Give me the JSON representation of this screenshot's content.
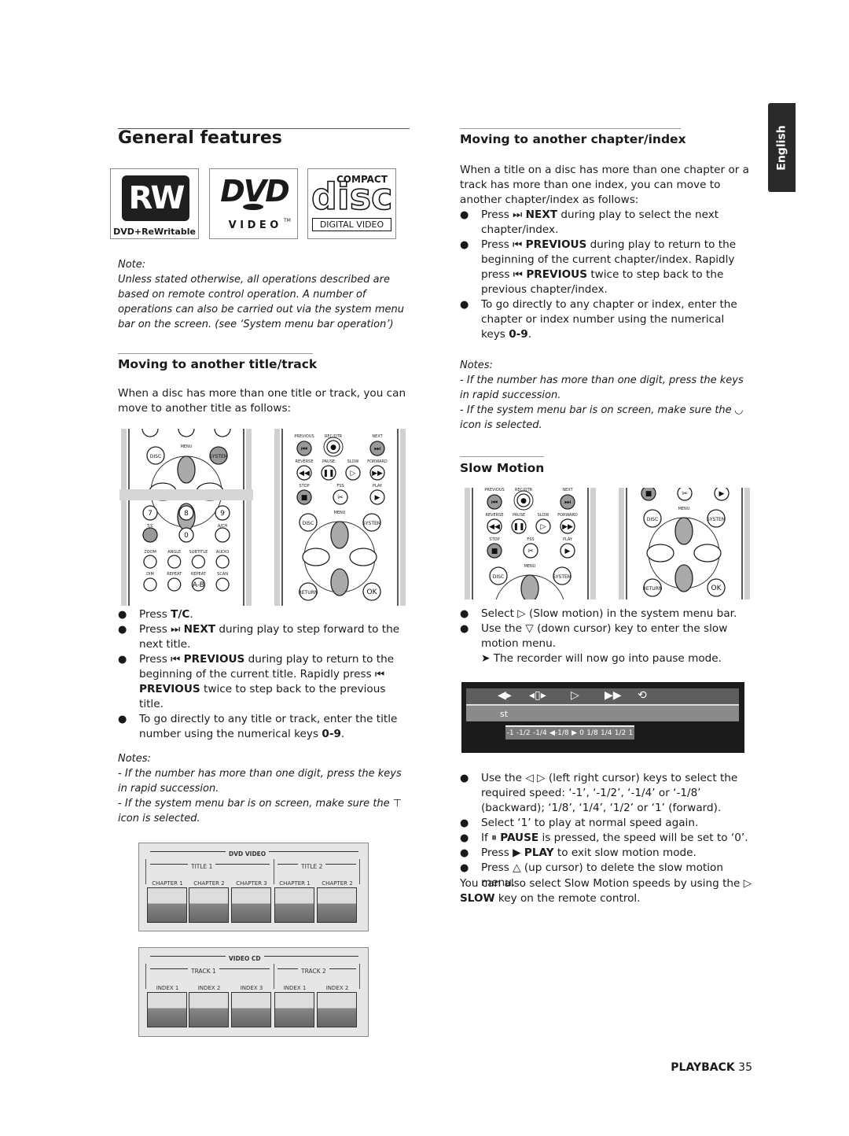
{
  "side_tab": "English",
  "left": {
    "title": "General features",
    "logos": {
      "rw": "RW",
      "rw_caption": "DVD+ReWritable",
      "dvd": "DVD",
      "dvd_sub": "V I D E O",
      "dvd_tm": "TM",
      "cd_top": "COMPACT",
      "cd_main": "disc",
      "cd_caption": "DIGITAL VIDEO"
    },
    "note_label": "Note:",
    "note_text": "Unless stated otherwise, all operations described are based on remote control operation. A number of operations can also be carried out via the system menu bar on the screen. (see ‘System menu bar operation’)",
    "section_title": "Moving to another title/track",
    "intro": "When a disc has more than one title or track, you can move to another title as follows:",
    "bullets": [
      {
        "pre": "Press ",
        "key": "T/C",
        "post": "."
      },
      {
        "pre": "Press ⏭ ",
        "key": "NEXT",
        "post": " during play to step forward to the next title."
      },
      {
        "pre": "Press ⏮ ",
        "key": "PREVIOUS",
        "post": " during play to return to the beginning of the current title. Rapidly press ⏮ ",
        "key2": "PREVIOUS",
        "post2": " twice to step back to the previous title."
      },
      {
        "pre": "To go directly to any title or track, enter the title number using the numerical keys ",
        "key": "0-9",
        "post": "."
      }
    ],
    "notes_label": "Notes:",
    "notes": [
      "- If the number has more than one digit, press the keys in rapid succession.",
      "- If the system menu bar is on screen, make sure the ⊤ icon is selected."
    ],
    "dvd_diagram": {
      "title": "DVD VIDEO",
      "groups": [
        "TITLE 1",
        "TITLE 2"
      ],
      "items": [
        "CHAPTER 1",
        "CHAPTER 2",
        "CHAPTER 3",
        "CHAPTER 1",
        "CHAPTER 2"
      ]
    },
    "vcd_diagram": {
      "title": "VIDEO CD",
      "groups": [
        "TRACK 1",
        "TRACK 2"
      ],
      "items": [
        "INDEX 1",
        "INDEX 2",
        "INDEX 3",
        "INDEX 1",
        "INDEX 2"
      ]
    }
  },
  "remote_a": {
    "menu": "MENU",
    "disc": "DISC",
    "system": "SYSTEM",
    "nums": [
      "7",
      "8",
      "9",
      "0"
    ],
    "tc": "T/C",
    "ach": "A/CH",
    "row1": [
      "ZOOM",
      "ANGLE",
      "SUBTITLE",
      "AUDIO"
    ],
    "row2": [
      "DIM",
      "REPEAT",
      "REPEAT",
      "SCAN"
    ],
    "ab": "A-B"
  },
  "remote_b": {
    "top": [
      "PREVIOUS",
      "REC/OTR",
      "NEXT"
    ],
    "mid": [
      "REVERSE",
      "PAUSE",
      "SLOW",
      "FORWARD"
    ],
    "low": [
      "STOP",
      "FSS",
      "PLAY"
    ],
    "menu": "MENU",
    "disc": "DISC",
    "system": "SYSTEM",
    "return": "RETURN",
    "ok": "OK"
  },
  "right": {
    "title": "Moving to another chapter/index",
    "intro": "When a title on a disc has more than one chapter or a track has more than one index, you can move to another chapter/index as follows:",
    "bullets": [
      {
        "pre": "Press ⏭ ",
        "key": "NEXT",
        "post": " during play to select the next chapter/index."
      },
      {
        "pre": "Press ⏮ ",
        "key": "PREVIOUS",
        "post": " during play to return to the beginning of the current chapter/index. Rapidly press ⏮ ",
        "key2": "PREVIOUS",
        "post2": " twice to step back to the previous chapter/index."
      },
      {
        "pre": "To go directly to any chapter or index, enter the chapter or index number using the numerical keys ",
        "key": "0-9",
        "post": "."
      }
    ],
    "notes_label": "Notes:",
    "notes": [
      "- If the number has more than one digit, press the keys in rapid succession.",
      "- If the system menu bar is on screen, make sure the ◡ icon is selected."
    ],
    "slow_title": "Slow Motion",
    "slow_bullets": [
      "Select ▷ (Slow motion) in the system menu bar.",
      "Use the ▽ (down cursor) key to enter the slow motion menu."
    ],
    "slow_result": "➤ The recorder will now go into pause mode.",
    "screen": {
      "label": "st",
      "scale": [
        "-1",
        "-1/2",
        "-1/4",
        "◀-1/8",
        "▶",
        "0",
        "1/8",
        "1/4",
        "1/2",
        "1"
      ]
    },
    "speed_bullets": [
      {
        "pre": "Use the ◁ ▷ (left right cursor) keys to select the required speed: ‘-1’, ‘-1/2’, ‘-1/4’ or ‘-1/8’ (backward); ‘1/8’, ‘1/4’, ‘1/2’ or ‘1’ (forward).",
        "key": "",
        "post": ""
      },
      {
        "pre": "Select ‘1’ to play at normal speed again.",
        "key": "",
        "post": ""
      },
      {
        "pre": "If ⏸ ",
        "key": "PAUSE",
        "post": " is pressed, the speed will be set to ‘0’."
      },
      {
        "pre": "Press ▶ ",
        "key": "PLAY",
        "post": " to exit slow motion mode."
      },
      {
        "pre": "Press △ (up cursor) to delete the slow motion menu.",
        "key": "",
        "post": ""
      }
    ],
    "closing_pre": "You can also select Slow Motion speeds by using the ▷ ",
    "closing_key": "SLOW",
    "closing_post": " key on the remote control."
  },
  "footer": {
    "section": "PLAYBACK",
    "page": "35"
  },
  "colors": {
    "tab": "#2a2a2a",
    "screen_bg": "#1b1b1b",
    "screen_bar": "#8a8a8a",
    "remote_gray": "#9a9a9a"
  }
}
